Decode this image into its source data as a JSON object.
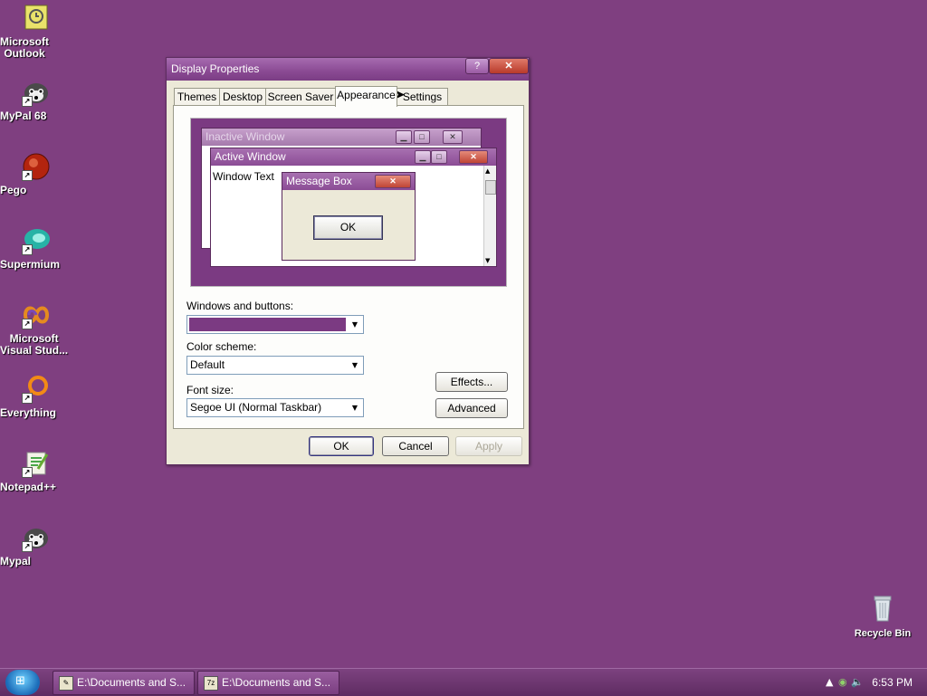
{
  "desktop": {
    "icons": [
      {
        "label": "Microsoft\nOutlook",
        "icon": "outlook-icon"
      },
      {
        "label": "MyPal 68",
        "icon": "raccoon-icon"
      },
      {
        "label": "Pego",
        "icon": "pego-icon"
      },
      {
        "label": "Supermium",
        "icon": "supermium-icon"
      },
      {
        "label": "Microsoft\nVisual Stud...",
        "icon": "visual-studio-icon"
      },
      {
        "label": "Everything",
        "icon": "everything-icon"
      },
      {
        "label": "Notepad++",
        "icon": "notepadpp-icon"
      },
      {
        "label": "Mypal",
        "icon": "raccoon-icon"
      }
    ],
    "recycle_bin": "Recycle Bin",
    "background_color": "#7f3f80"
  },
  "dialog": {
    "title": "Display Properties",
    "help_btn": "?",
    "close_btn": "✕",
    "tabs": [
      {
        "label": "Themes"
      },
      {
        "label": "Desktop"
      },
      {
        "label": "Screen Saver"
      },
      {
        "label": "Appearance",
        "active": true
      },
      {
        "label": "Settings"
      }
    ],
    "preview": {
      "inactive_title": "Inactive Window",
      "active_title": "Active Window",
      "window_text": "Window Text",
      "message_box_title": "Message Box",
      "ok": "OK"
    },
    "windows_buttons_label": "Windows and buttons:",
    "windows_buttons_value": "",
    "color_scheme_label": "Color scheme:",
    "color_scheme_value": "Default",
    "font_size_label": "Font size:",
    "font_size_value": "Segoe UI (Normal Taskbar)",
    "effects_btn": "Effects...",
    "advanced_btn": "Advanced",
    "ok_btn": "OK",
    "cancel_btn": "Cancel",
    "apply_btn": "Apply"
  },
  "taskbar": {
    "items": [
      {
        "label": "E:\\Documents and S..."
      },
      {
        "label": "E:\\Documents and S..."
      }
    ],
    "clock": "6:53 PM"
  }
}
